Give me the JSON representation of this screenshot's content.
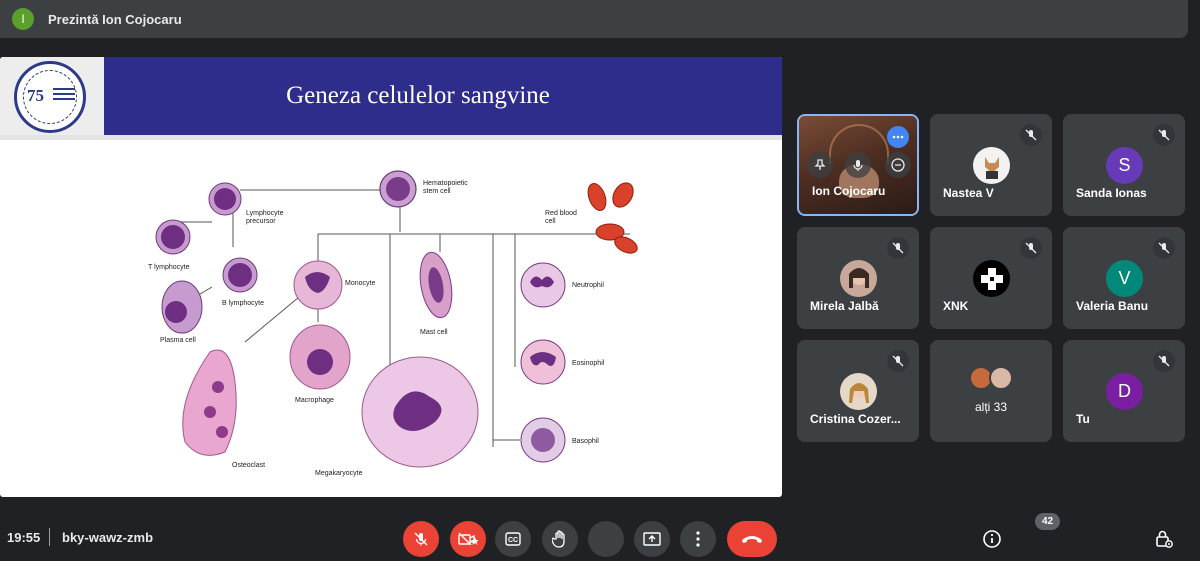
{
  "topbar": {
    "presenter_initial": "I",
    "presenter_label": "Prezintă Ion Cojocaru"
  },
  "slide": {
    "title": "Geneza celulelor sangvine",
    "logo_number": "75",
    "labels": {
      "hematopoietic": "Hematopoietic",
      "stem_cell": "stem cell",
      "red_blood": "Red blood",
      "cell": "cell",
      "lymphocyte": "Lymphocyte",
      "precursor": "precursor",
      "t_lymphocyte": "T lymphocyte",
      "b_lymphocyte": "B lymphocyte",
      "plasma_cell": "Plasma cell",
      "monocyte": "Monocyte",
      "mast_cell": "Mast cell",
      "neutrophil": "Neutrophil",
      "eosinophil": "Eosinophil",
      "basophil": "Basophil",
      "macrophage": "Macrophage",
      "osteoclast": "Osteoclast",
      "megakaryocyte": "Megakaryocyte"
    }
  },
  "participants": [
    {
      "name": "Ion Cojocaru",
      "type": "video"
    },
    {
      "name": "Nastea V",
      "type": "photo"
    },
    {
      "name": "Sanda Ionas",
      "type": "initial",
      "initial": "S",
      "color": "#673ab7"
    },
    {
      "name": "Mirela Jalbă",
      "type": "photo"
    },
    {
      "name": "XNK",
      "type": "photo"
    },
    {
      "name": "Valeria Banu",
      "type": "initial",
      "initial": "V",
      "color": "#00897b"
    },
    {
      "name": "Cristina Cozer...",
      "type": "photo"
    },
    {
      "name": "alți 33",
      "type": "others"
    },
    {
      "name": "Tu",
      "type": "initial",
      "initial": "D",
      "color": "#7b1fa2"
    }
  ],
  "bottombar": {
    "time": "19:55",
    "meeting_code": "bky-wawz-zmb",
    "participant_count": "42"
  },
  "colors": {
    "background": "#202124",
    "tile": "#3c4043",
    "danger": "#ea4335",
    "slide_header": "#2e2d8c",
    "accent": "#8ab4f8"
  }
}
